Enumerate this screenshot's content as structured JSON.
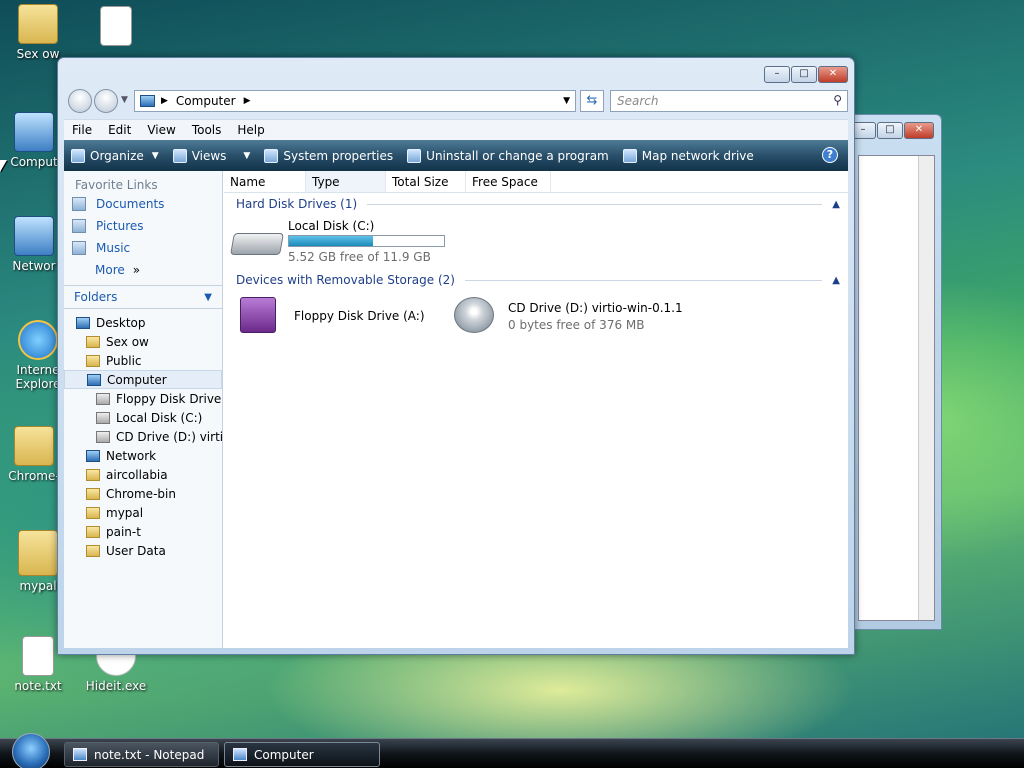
{
  "desktop": {
    "icons": [
      {
        "label": "Sex ow",
        "icon": "folder-icon"
      },
      {
        "label": "",
        "icon": "text-file-icon"
      },
      {
        "label": "Comput",
        "icon": "computer-icon"
      },
      {
        "label": "Networ",
        "icon": "network-icon"
      },
      {
        "label": "Interne Explore",
        "icon": "internet-explorer-icon"
      },
      {
        "label": "Chrome-",
        "icon": "folder-icon"
      },
      {
        "label": "mypal",
        "icon": "folder-icon"
      },
      {
        "label": "note.txt",
        "icon": "text-file-icon"
      },
      {
        "label": "Hideit.exe",
        "icon": "exe-icon"
      }
    ]
  },
  "explorer": {
    "address": {
      "location": "Computer"
    },
    "search": {
      "placeholder": "Search"
    },
    "menu": [
      "File",
      "Edit",
      "View",
      "Tools",
      "Help"
    ],
    "toolbar": {
      "organize": "Organize",
      "views": "Views",
      "system_properties": "System properties",
      "uninstall": "Uninstall or change a program",
      "map_drive": "Map network drive"
    },
    "nav": {
      "favorite_links_header": "Favorite Links",
      "favorites": [
        "Documents",
        "Pictures",
        "Music"
      ],
      "more": "More",
      "folders_header": "Folders",
      "tree": [
        {
          "label": "Desktop",
          "icon": "desktop-icon",
          "level": 0
        },
        {
          "label": "Sex ow",
          "icon": "folder-icon",
          "level": 1
        },
        {
          "label": "Public",
          "icon": "folder-icon",
          "level": 1
        },
        {
          "label": "Computer",
          "icon": "computer-icon",
          "level": 1,
          "selected": true
        },
        {
          "label": "Floppy Disk Drive",
          "icon": "floppy-icon",
          "level": 2
        },
        {
          "label": "Local Disk (C:)",
          "icon": "drive-icon",
          "level": 2
        },
        {
          "label": "CD Drive (D:) virtio",
          "icon": "cd-drive-icon",
          "level": 2
        },
        {
          "label": "Network",
          "icon": "network-icon",
          "level": 1
        },
        {
          "label": "aircollabia",
          "icon": "folder-icon",
          "level": 1
        },
        {
          "label": "Chrome-bin",
          "icon": "folder-icon",
          "level": 1
        },
        {
          "label": "mypal",
          "icon": "folder-icon",
          "level": 1
        },
        {
          "label": "pain-t",
          "icon": "folder-icon",
          "level": 1
        },
        {
          "label": "User Data",
          "icon": "folder-icon",
          "level": 1
        }
      ]
    },
    "columns": [
      "Name",
      "Type",
      "Total Size",
      "Free Space"
    ],
    "groups": {
      "hdd": "Hard Disk Drives (1)",
      "removable": "Devices with Removable Storage (2)"
    },
    "drives": {
      "c": {
        "name": "Local Disk (C:)",
        "free": "5.52 GB free of 11.9 GB",
        "used_fraction": 0.54
      },
      "a": {
        "name": "Floppy Disk Drive (A:)"
      },
      "d": {
        "name": "CD Drive (D:) virtio-win-0.1.1",
        "free": "0 bytes free of 376 MB"
      }
    }
  },
  "taskbar": {
    "items": [
      "note.txt - Notepad",
      "Computer"
    ]
  }
}
